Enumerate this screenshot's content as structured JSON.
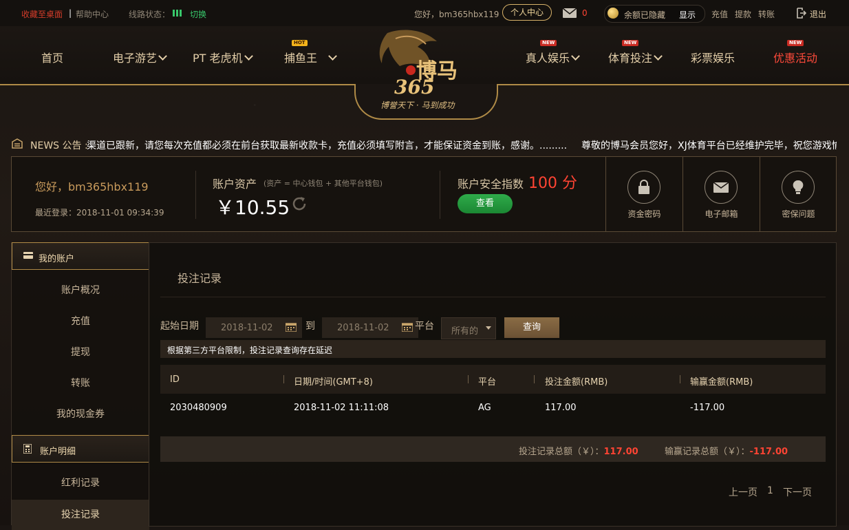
{
  "topbar": {
    "bookmark": "收藏至桌面",
    "help": "帮助中心",
    "line_status_label": "线路状态：",
    "line_switch": "切换",
    "greeting": "您好，bm365hbx119",
    "personal_center": "个人中心",
    "mail_count": "0",
    "balance_hidden": "余额已隐藏",
    "show": "显示",
    "deposit": "充值",
    "withdraw": "提款",
    "transfer": "转账",
    "logout": "退出"
  },
  "nav": {
    "home": "首页",
    "egames": "电子游艺",
    "pt_slots": "PT 老虎机",
    "fishing": "捕鱼王",
    "fishing_badge": "HOT",
    "live": "真人娱乐",
    "live_badge": "NEW",
    "sports": "体育投注",
    "sports_badge": "NEW",
    "lottery": "彩票娱乐",
    "promo": "优惠活动",
    "promo_badge": "NEW"
  },
  "logo": {
    "brand": "博马",
    "number": "365",
    "slogan": "博誉天下 · 马到成功"
  },
  "news": {
    "label": "NEWS 公告 :",
    "message1": "渠道已跟新，请您每次充值都必须在前台获取最新收款卡，充值必须填写附言，才能保证资金到账，感谢。.........",
    "message2": "尊敬的博马会员您好，XJ体育平台已经维护完毕，祝您游戏愉快"
  },
  "account": {
    "hello": "您好，bm365hbx119",
    "last_login": "最近登录：2018-11-01 09:34:39",
    "asset_title": "账户资产",
    "asset_sub": "(资产 = 中心钱包 + 其他平台钱包)",
    "asset_value": "￥10.55",
    "security_title": "账户安全指数",
    "security_value": "100 分",
    "check_button": "查看",
    "fund_password": "资金密码",
    "email": "电子邮箱",
    "security_question": "密保问题"
  },
  "sidebar": {
    "my_account": "我的账户",
    "items1": [
      "账户概况",
      "充值",
      "提现",
      "转账",
      "我的现金券"
    ],
    "details": "账户明细",
    "items2": [
      "红利记录",
      "投注记录"
    ]
  },
  "main": {
    "title": "投注记录",
    "start_date_label": "起始日期",
    "start_date": "2018-11-02",
    "to_label": "到",
    "end_date": "2018-11-02",
    "platform_label": "平台",
    "platform_value": "所有的",
    "query_button": "查询",
    "notice": "根据第三方平台限制，投注记录查询存在延迟",
    "columns": [
      "ID",
      "日期/时间(GMT+8)",
      "平台",
      "投注金额(RMB)",
      "输赢金额(RMB)"
    ],
    "rows": [
      {
        "id": "2030480909",
        "datetime": "2018-11-02 11:11:08",
        "platform": "AG",
        "bet": "117.00",
        "winloss": "-117.00"
      }
    ],
    "total_bet_label": "投注记录总额（￥）：",
    "total_bet": "117.00",
    "total_winloss_label": "输赢记录总额（￥）：",
    "total_winloss": "-117.00",
    "prev": "上一页",
    "page": "1",
    "next": "下一页"
  },
  "colors": {
    "accent_gold": "#b08b47",
    "red": "#ff4433",
    "green": "#1b8733"
  }
}
